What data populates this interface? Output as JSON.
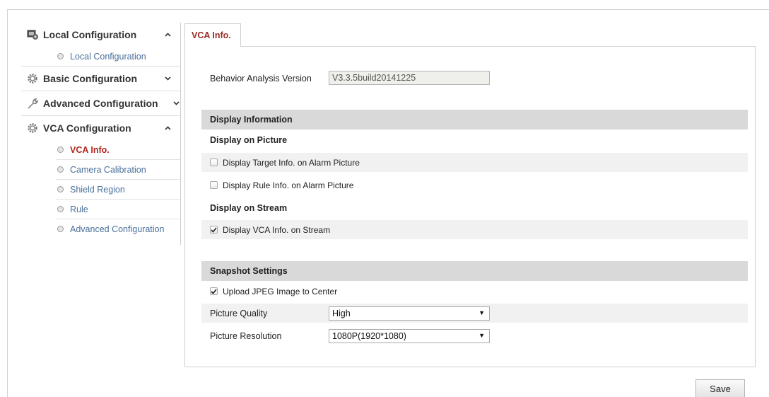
{
  "sidebar": {
    "groups": [
      {
        "label": "Local Configuration",
        "icon": "local-config-icon",
        "expanded": true,
        "items": [
          {
            "label": "Local Configuration"
          }
        ]
      },
      {
        "label": "Basic Configuration",
        "icon": "gear-icon",
        "expanded": false,
        "items": []
      },
      {
        "label": "Advanced Configuration",
        "icon": "wrench-icon",
        "expanded": false,
        "items": []
      },
      {
        "label": "VCA Configuration",
        "icon": "gear-icon",
        "expanded": true,
        "items": [
          {
            "label": "VCA Info.",
            "active": true
          },
          {
            "label": "Camera Calibration"
          },
          {
            "label": "Shield Region"
          },
          {
            "label": "Rule"
          },
          {
            "label": "Advanced Configuration"
          }
        ]
      }
    ]
  },
  "tab": {
    "label": "VCA Info."
  },
  "version": {
    "label": "Behavior Analysis Version",
    "value": "V3.3.5build20141225"
  },
  "display_info": {
    "title": "Display Information",
    "on_picture_label": "Display on Picture",
    "target_info": {
      "label": "Display Target Info. on Alarm Picture",
      "checked": false
    },
    "rule_info": {
      "label": "Display Rule Info. on Alarm Picture",
      "checked": false
    },
    "on_stream_label": "Display on Stream",
    "vca_stream": {
      "label": "Display VCA Info. on Stream",
      "checked": true
    }
  },
  "snapshot": {
    "title": "Snapshot Settings",
    "upload": {
      "label": "Upload JPEG Image to Center",
      "checked": true
    },
    "quality": {
      "label": "Picture Quality",
      "value": "High"
    },
    "resolution": {
      "label": "Picture Resolution",
      "value": "1080P(1920*1080)"
    }
  },
  "save_label": "Save",
  "colors": {
    "active": "#b3261e",
    "link": "#4a6f9a",
    "section_bg": "#d9d9d9",
    "row_shade": "#f1f1f1"
  }
}
